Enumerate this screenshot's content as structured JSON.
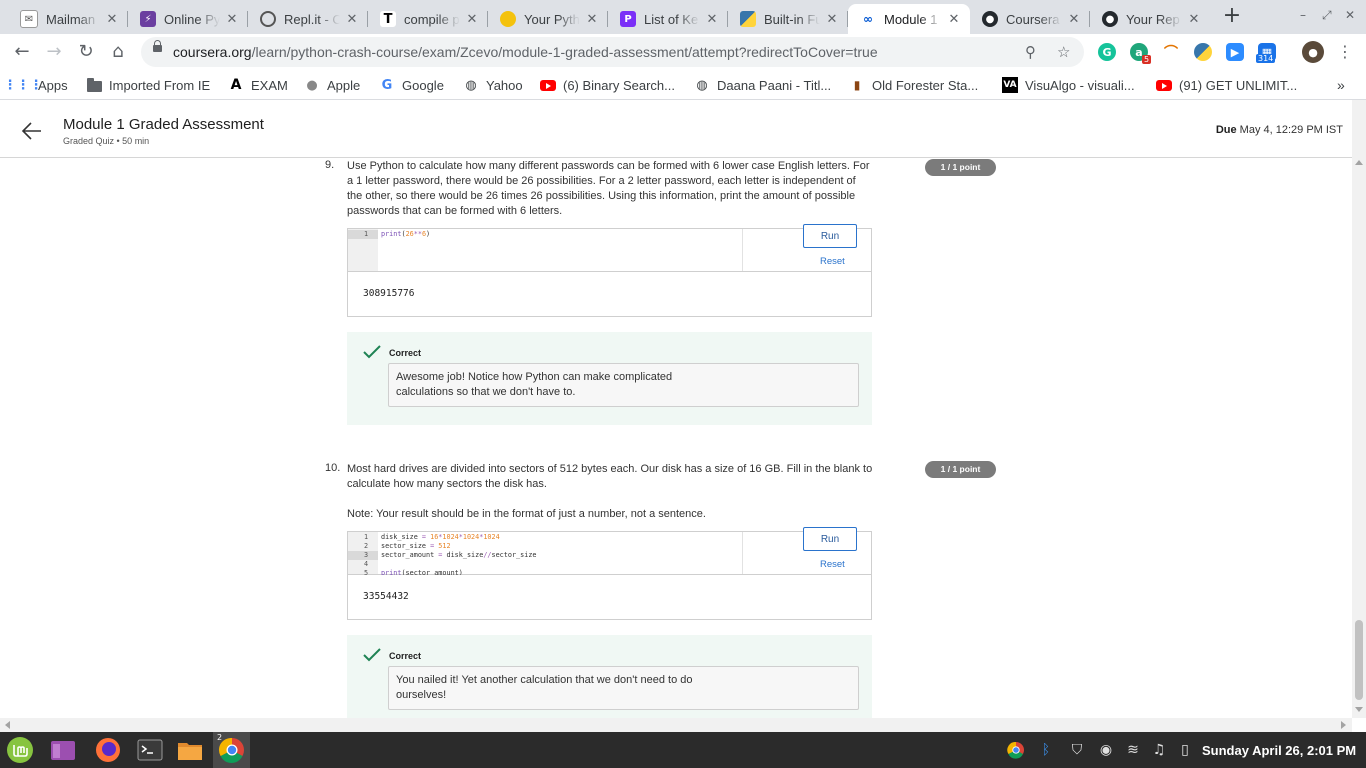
{
  "browser": {
    "tabs": [
      {
        "title": "Mailman :",
        "icon": "mailman-icon"
      },
      {
        "title": "Online Py",
        "icon": "bolt-icon"
      },
      {
        "title": "Repl.it - C",
        "icon": "replit-icon"
      },
      {
        "title": "compile p",
        "icon": "t-icon"
      },
      {
        "title": "Your Pyth",
        "icon": "python-course-icon"
      },
      {
        "title": "List of Ke",
        "icon": "list-icon"
      },
      {
        "title": "Built-in Fu",
        "icon": "python-icon"
      },
      {
        "title": "Module 1",
        "icon": "coursera-icon"
      },
      {
        "title": "Coursera",
        "icon": "github-icon"
      },
      {
        "title": "Your Rep",
        "icon": "github-icon"
      }
    ],
    "url_host": "coursera.org",
    "url_path": "/learn/python-crash-course/exam/Zcevo/module-1-graded-assessment/attempt?redirectToCover=true",
    "extension_badges": {
      "grammarly_count": "5",
      "zoom_count": "314"
    },
    "bookmarks": [
      {
        "label": "Apps",
        "icon": "apps-grid-icon"
      },
      {
        "label": "Imported From IE",
        "icon": "folder-icon"
      },
      {
        "label": "EXAM",
        "icon": "a-logo-icon"
      },
      {
        "label": "Apple",
        "icon": "apple-icon"
      },
      {
        "label": "Google",
        "icon": "google-icon"
      },
      {
        "label": "Yahoo",
        "icon": "globe-icon"
      },
      {
        "label": "(6) Binary Search...",
        "icon": "youtube-icon"
      },
      {
        "label": "Daana Paani - Titl...",
        "icon": "globe-icon"
      },
      {
        "label": "Old Forester Sta...",
        "icon": "bottle-icon"
      },
      {
        "label": "VisuAlgo - visuali...",
        "icon": "visualgo-icon"
      },
      {
        "label": "(91) GET UNLIMIT...",
        "icon": "youtube-icon"
      }
    ],
    "more_bookmarks": "»"
  },
  "header": {
    "title": "Module 1 Graded Assessment",
    "subtitle": "Graded Quiz • 50 min",
    "due_label": "Due",
    "due_date": "May 4, 12:29 PM IST"
  },
  "questions": [
    {
      "number": "9.",
      "text": "Use Python to calculate how many different passwords can be formed with 6 lower case English letters. For a 1 letter password, there would be 26 possibilities. For a 2 letter password, each letter is independent of the other, so there would be 26 times 26 possibilities. Using this information, print the amount of possible passwords that can be formed with 6 letters.",
      "note": "",
      "points": "1 / 1 point",
      "run_label": "Run",
      "reset_label": "Reset",
      "code_lines": [
        "print(26**6)"
      ],
      "output": "308915776",
      "result_label": "Correct",
      "feedback": "Awesome job!  Notice how Python can make complicated calculations so that we don't have to."
    },
    {
      "number": "10.",
      "text": "Most hard drives are divided into sectors of 512 bytes each. Our disk has a size of 16 GB. Fill in the blank to calculate how many sectors the disk has.",
      "note": "Note: Your result should be in the format of just a number, not a sentence.",
      "points": "1 / 1 point",
      "run_label": "Run",
      "reset_label": "Reset",
      "code_lines": [
        "disk_size = 16*1024*1024*1024",
        "sector_size = 512",
        "sector_amount = disk_size//sector_size",
        "",
        "print(sector_amount)"
      ],
      "output": "33554432",
      "result_label": "Correct",
      "feedback": "You nailed it! Yet another calculation that we don't need to do ourselves!"
    }
  ],
  "taskbar": {
    "clock": "Sunday April 26,  2:01 PM",
    "chrome_window_count": "2"
  },
  "colors": {
    "points_badge": "#7b7b7b",
    "correct_green": "#1f8354",
    "feedback_bg": "#f0f8f4",
    "link_blue": "#2a73cc"
  }
}
